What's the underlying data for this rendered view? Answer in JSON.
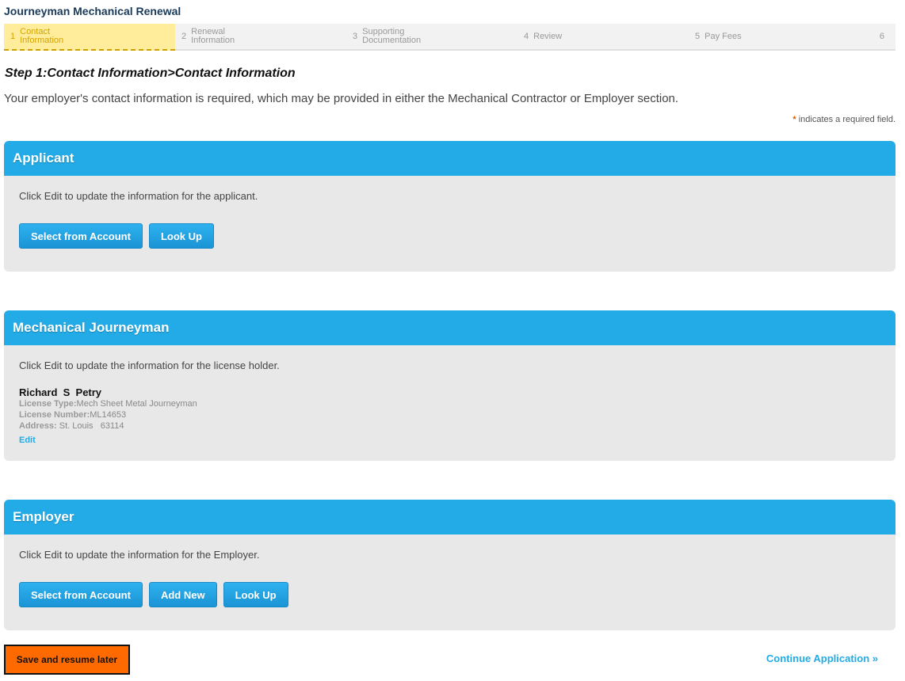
{
  "page_title": "Journeyman Mechanical Renewal",
  "steps": [
    {
      "num": "1",
      "label_line1": "Contact",
      "label_line2": "Information",
      "active": true
    },
    {
      "num": "2",
      "label_line1": "Renewal",
      "label_line2": "Information"
    },
    {
      "num": "3",
      "label_line1": "Supporting",
      "label_line2": "Documentation"
    },
    {
      "num": "4",
      "label_line1": "Review",
      "label_line2": ""
    },
    {
      "num": "5",
      "label_line1": "Pay Fees",
      "label_line2": ""
    },
    {
      "num": "6",
      "label_line1": "",
      "label_line2": ""
    }
  ],
  "step_heading": {
    "prefix": "Step 1:",
    "section": "Contact Information",
    "separator": ">",
    "subsection": "Contact Information"
  },
  "intro_text": "Your employer's contact information is required, which may be provided in either the Mechanical Contractor or Employer section.",
  "required_note": {
    "star": "*",
    "text": "indicates a required field."
  },
  "applicant": {
    "title": "Applicant",
    "instruction": "Click Edit to update the information for the applicant.",
    "select_label": "Select from Account",
    "lookup_label": "Look Up"
  },
  "journeyman": {
    "title": "Mechanical Journeyman",
    "instruction": "Click Edit to update the information for the license holder.",
    "name": "Richard  S  Petry",
    "license_type_label": "License Type:",
    "license_type": "Mech Sheet Metal Journeyman",
    "license_number_label": "License Number:",
    "license_number": "ML14653",
    "address_label": "Address:",
    "address": " St. Louis   63114",
    "edit_label": "Edit"
  },
  "employer": {
    "title": "Employer",
    "instruction": "Click Edit to update the information for the Employer.",
    "select_label": "Select from Account",
    "add_label": "Add New",
    "lookup_label": "Look Up"
  },
  "footer": {
    "save_label": "Save and resume later",
    "continue_label": "Continue Application »"
  },
  "colors": {
    "accent": "#22abe6",
    "active_step_bg": "#ffed9c",
    "save_button": "#ff6a00"
  }
}
